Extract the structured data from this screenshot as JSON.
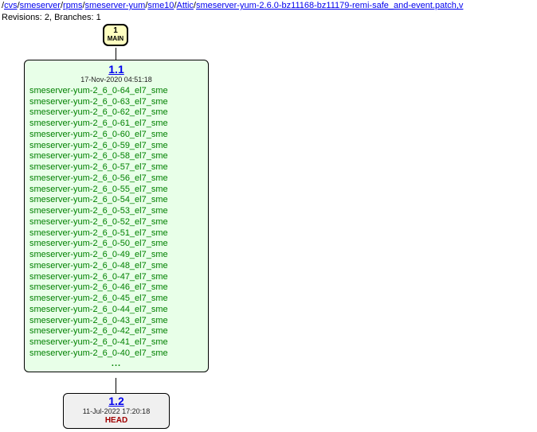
{
  "header": {
    "path_segments": [
      "cvs",
      "smeserver",
      "rpms",
      "smeserver-yum",
      "sme10",
      "Attic",
      "smeserver-yum-2.6.0-bz11168-bz11179-remi-safe_and-event.patch,v"
    ],
    "revisions_label": "Revisions:",
    "revisions_count": "2,",
    "branches_label": "Branches:",
    "branches_count": "1"
  },
  "main_badge": {
    "number": "1",
    "label": "MAIN"
  },
  "rev11": {
    "number": "1.1",
    "date": "17-Nov-2020 04:51:18",
    "tags": [
      "smeserver-yum-2_6_0-64_el7_sme",
      "smeserver-yum-2_6_0-63_el7_sme",
      "smeserver-yum-2_6_0-62_el7_sme",
      "smeserver-yum-2_6_0-61_el7_sme",
      "smeserver-yum-2_6_0-60_el7_sme",
      "smeserver-yum-2_6_0-59_el7_sme",
      "smeserver-yum-2_6_0-58_el7_sme",
      "smeserver-yum-2_6_0-57_el7_sme",
      "smeserver-yum-2_6_0-56_el7_sme",
      "smeserver-yum-2_6_0-55_el7_sme",
      "smeserver-yum-2_6_0-54_el7_sme",
      "smeserver-yum-2_6_0-53_el7_sme",
      "smeserver-yum-2_6_0-52_el7_sme",
      "smeserver-yum-2_6_0-51_el7_sme",
      "smeserver-yum-2_6_0-50_el7_sme",
      "smeserver-yum-2_6_0-49_el7_sme",
      "smeserver-yum-2_6_0-48_el7_sme",
      "smeserver-yum-2_6_0-47_el7_sme",
      "smeserver-yum-2_6_0-46_el7_sme",
      "smeserver-yum-2_6_0-45_el7_sme",
      "smeserver-yum-2_6_0-44_el7_sme",
      "smeserver-yum-2_6_0-43_el7_sme",
      "smeserver-yum-2_6_0-42_el7_sme",
      "smeserver-yum-2_6_0-41_el7_sme",
      "smeserver-yum-2_6_0-40_el7_sme"
    ],
    "more": "..."
  },
  "rev12": {
    "number": "1.2",
    "date": "11-Jul-2022 17:20:18",
    "branch": "HEAD"
  }
}
